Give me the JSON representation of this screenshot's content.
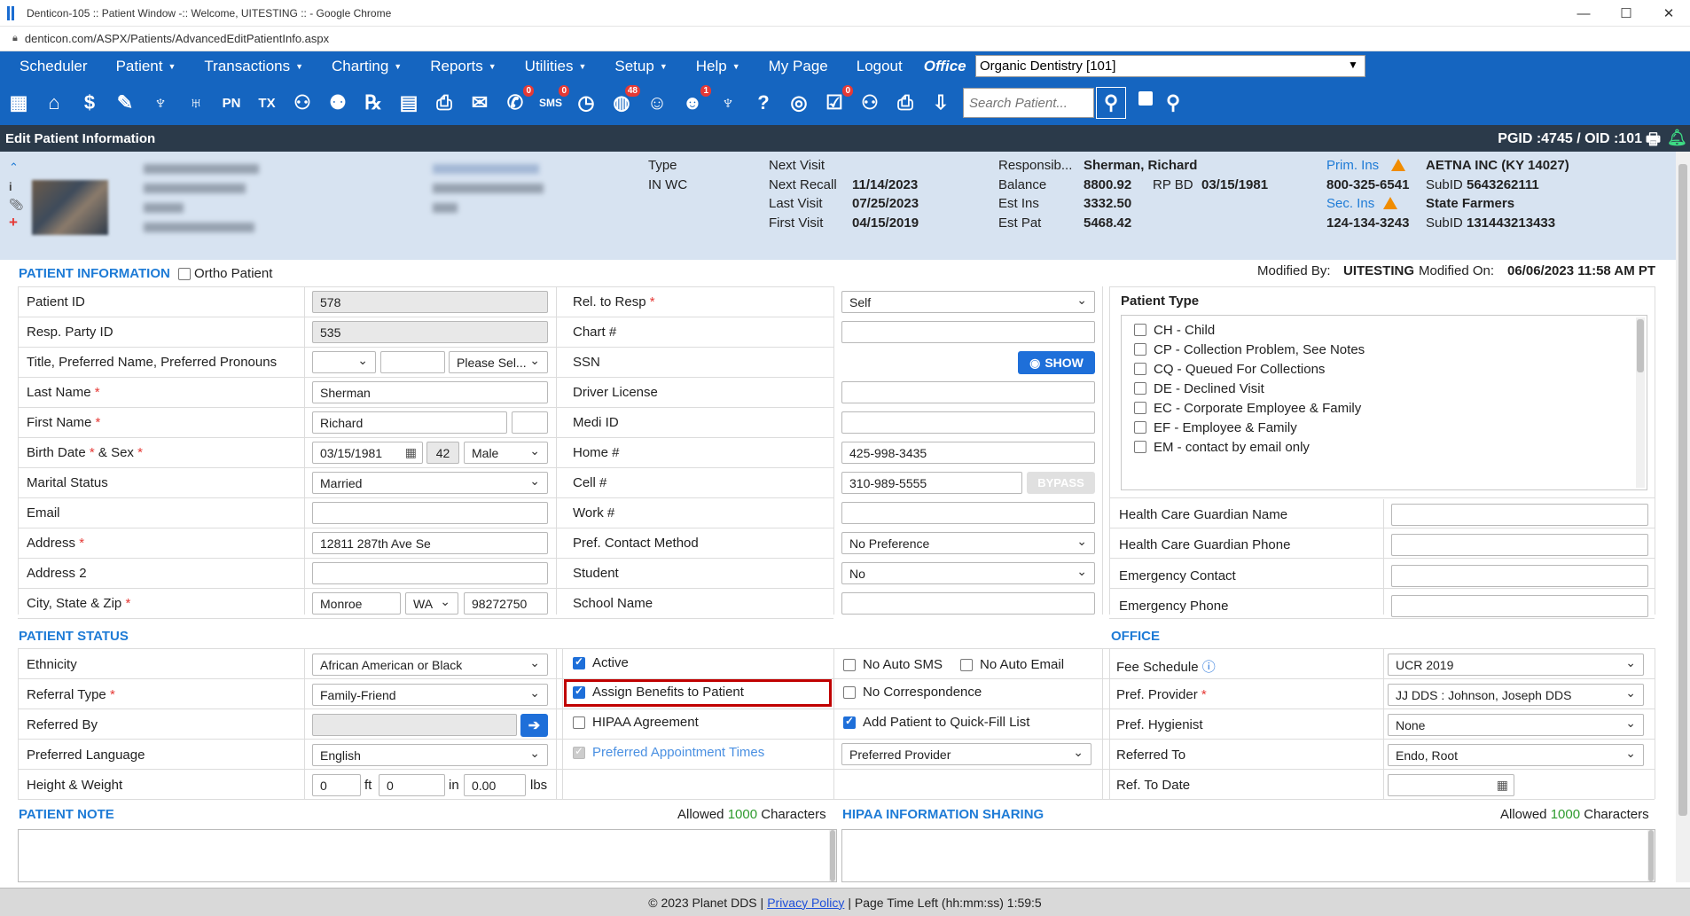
{
  "browser": {
    "title": "Denticon-105 :: Patient Window -:: Welcome, UITESTING :: - Google Chrome",
    "url": "denticon.com/ASPX/Patients/AdvancedEditPatientInfo.aspx",
    "controls": [
      "—",
      "☐",
      "✕"
    ]
  },
  "menu": {
    "items": [
      {
        "label": "Scheduler",
        "caret": false
      },
      {
        "label": "Patient",
        "caret": true
      },
      {
        "label": "Transactions",
        "caret": true
      },
      {
        "label": "Charting",
        "caret": true
      },
      {
        "label": "Reports",
        "caret": true
      },
      {
        "label": "Utilities",
        "caret": true
      },
      {
        "label": "Setup",
        "caret": true
      },
      {
        "label": "Help",
        "caret": true
      },
      {
        "label": "My Page",
        "caret": false
      },
      {
        "label": "Logout",
        "caret": false
      }
    ],
    "office_label": "Office",
    "office_value": "Organic Dentistry [101]"
  },
  "toolbar": {
    "icons": [
      "calendar-icon",
      "home-icon",
      "dollar-icon",
      "edit-icon",
      "tooth-icon",
      "teeth-icon",
      "pn-icon",
      "tx-icon",
      "add-patient-icon",
      "add-family-icon",
      "rx-icon",
      "notes-icon",
      "printer-doc-icon",
      "mail-icon",
      "chat-icon",
      "sms-icon",
      "clock-icon",
      "globe-icon",
      "group-icon",
      "support-icon",
      "tooth-outline-icon",
      "question-icon",
      "web-icon",
      "checklist-icon",
      "family-icon",
      "print-icon",
      "download-icon"
    ],
    "badges": {
      "chat-icon": "0",
      "sms-icon": "0",
      "globe-icon": "48",
      "support-icon": "1",
      "checklist-icon": "0"
    },
    "search_placeholder": "Search Patient..."
  },
  "header": {
    "title": "Edit Patient Information",
    "ids": "PGID :4745  /  OID :101"
  },
  "summary": {
    "type_label": "Type",
    "type_value": "IN WC",
    "next_visit_label": "Next Visit",
    "next_recall_label": "Next Recall",
    "next_recall_value": "11/14/2023",
    "last_visit_label": "Last Visit",
    "last_visit_value": "07/25/2023",
    "first_visit_label": "First Visit",
    "first_visit_value": "04/15/2019",
    "resp_label": "Responsib...",
    "resp_value": "Sherman, Richard",
    "balance_label": "Balance",
    "balance_value": "8800.92",
    "rpbd_label": "RP BD",
    "rpbd_value": "03/15/1981",
    "est_ins_label": "Est Ins",
    "est_ins_value": "3332.50",
    "est_pat_label": "Est Pat",
    "est_pat_value": "5468.42",
    "prim_ins_label": "Prim. Ins",
    "prim_ins_value": "AETNA INC (KY 14027)",
    "prim_phone": "800-325-6541",
    "prim_subid_label": "SubID",
    "prim_subid": "5643262111",
    "sec_ins_label": "Sec. Ins",
    "sec_ins_value": "State Farmers",
    "sec_phone": "124-134-3243",
    "sec_subid_label": "SubID",
    "sec_subid": "131443213433"
  },
  "patient_info": {
    "section_title": "PATIENT INFORMATION",
    "ortho_label": "Ortho Patient",
    "modified_by_label": "Modified By:",
    "modified_by": "UITESTING",
    "modified_on_label": "Modified On:",
    "modified_on": "06/06/2023 11:58 AM PT",
    "patient_id_label": "Patient ID",
    "patient_id": "578",
    "resp_id_label": "Resp. Party ID",
    "resp_id": "535",
    "title_label": "Title, Preferred Name, Preferred Pronouns",
    "pronoun_value": "Please Sel...",
    "last_name_label": "Last Name",
    "last_name": "Sherman",
    "first_name_label": "First Name",
    "first_name": "Richard",
    "birth_label": "Birth Date",
    "sex_label": "& Sex",
    "birth_date": "03/15/1981",
    "age": "42",
    "sex": "Male",
    "marital_label": "Marital Status",
    "marital": "Married",
    "email_label": "Email",
    "address_label": "Address",
    "address": "12811 287th Ave Se",
    "address2_label": "Address 2",
    "csz_label": "City, State & Zip",
    "city": "Monroe",
    "state": "WA",
    "zip": "98272750",
    "rel_resp_label": "Rel. to Resp",
    "rel_resp": "Self",
    "chart_label": "Chart #",
    "ssn_label": "SSN",
    "show_btn": "SHOW",
    "dl_label": "Driver License",
    "medi_label": "Medi ID",
    "home_label": "Home #",
    "home": "425-998-3435",
    "cell_label": "Cell #",
    "cell": "310-989-5555",
    "bypass_btn": "BYPASS",
    "work_label": "Work #",
    "pref_contact_label": "Pref. Contact Method",
    "pref_contact": "No Preference",
    "student_label": "Student",
    "student": "No",
    "school_label": "School Name",
    "ptype_label": "Patient Type",
    "ptypes": [
      "CH - Child",
      "CP - Collection Problem, See Notes",
      "CQ - Queued For Collections",
      "DE - Declined Visit",
      "EC - Corporate Employee & Family",
      "EF - Employee & Family",
      "EM - contact by email only"
    ],
    "hc_name_label": "Health Care Guardian Name",
    "hc_phone_label": "Health Care Guardian Phone",
    "em_contact_label": "Emergency Contact",
    "em_phone_label": "Emergency Phone"
  },
  "patient_status": {
    "section_title": "PATIENT STATUS",
    "ethnicity_label": "Ethnicity",
    "ethnicity": "African American or Black",
    "referral_label": "Referral Type",
    "referral": "Family-Friend",
    "referred_by_label": "Referred By",
    "language_label": "Preferred Language",
    "language": "English",
    "hw_label": "Height & Weight",
    "ft": "0",
    "ft_unit": "ft",
    "in": "0",
    "in_unit": "in",
    "lbs": "0.00",
    "lbs_unit": "lbs",
    "active_label": "Active",
    "assign_label": "Assign Benefits to Patient",
    "hipaa_label": "HIPAA Agreement",
    "pref_appt_label": "Preferred Appointment Times",
    "no_sms_label": "No Auto SMS",
    "no_email_label": "No Auto Email",
    "no_corr_label": "No Correspondence",
    "quickfill_label": "Add Patient to Quick-Fill List",
    "pref_provider_select": "Preferred Provider"
  },
  "office": {
    "section_title": "OFFICE",
    "fee_label": "Fee Schedule",
    "fee": "UCR 2019",
    "provider_label": "Pref. Provider",
    "provider": "JJ DDS : Johnson, Joseph DDS",
    "hygienist_label": "Pref. Hygienist",
    "hygienist": "None",
    "referred_to_label": "Referred To",
    "referred_to": "Endo, Root",
    "ref_date_label": "Ref. To Date"
  },
  "notes": {
    "patient_note_title": "PATIENT NOTE",
    "hipaa_title": "HIPAA INFORMATION SHARING",
    "allowed_prefix": "Allowed",
    "allowed_count": "1000",
    "allowed_suffix": "Characters"
  },
  "footer": {
    "copyright": "© 2023 Planet DDS |",
    "privacy": "Privacy Policy",
    "time_left": "| Page Time Left (hh:mm:ss) 1:59:5"
  },
  "colors": {
    "brand_blue": "#1565c0",
    "link_blue": "#1e7bd6",
    "header_dark": "#2b3a4a",
    "summary_bg": "#d7e3f1",
    "highlight_red": "#c00000",
    "warning_orange": "#f08c00"
  }
}
